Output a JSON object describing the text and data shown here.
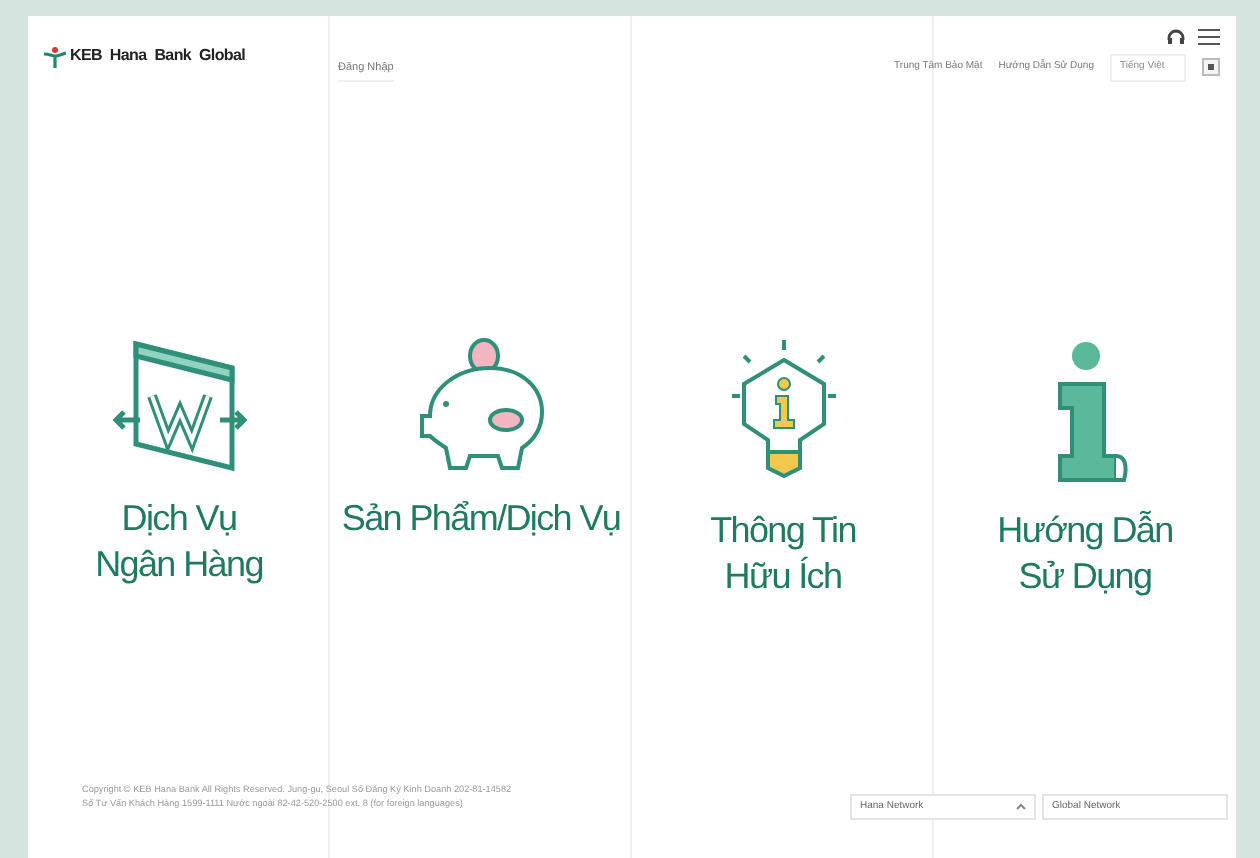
{
  "header": {
    "logo": "KEB Hana Bank Global",
    "login": "Đăng Nhập",
    "links": [
      "Trung Tâm Bảo Mật",
      "Hướng Dẫn Sử Dụng"
    ],
    "language": {
      "value": "Tiếng Việt"
    }
  },
  "menu": [
    {
      "kind": "banking",
      "lines": [
        "Dịch Vụ",
        "Ngân Hàng"
      ]
    },
    {
      "kind": "products",
      "lines": [
        "Sản Phẩm/Dịch Vụ"
      ]
    },
    {
      "kind": "info",
      "lines": [
        "Thông Tin",
        "Hữu Ích"
      ]
    },
    {
      "kind": "guide",
      "lines": [
        "Hướng Dẫn",
        "Sử Dụng"
      ]
    }
  ],
  "footer": {
    "copyright": [
      "Copyright © KEB Hana Bank All Rights Reserved. Jung-gu, Seoul Số Đăng Ký Kinh Doanh 202-81-14582",
      "Số Tư Vấn Khách Hàng 1599-1111 Nước ngoài 82-42-520-2500 ext. 8 (for foreign languages)"
    ],
    "selects": [
      "Hana Network",
      "Global Network"
    ]
  }
}
